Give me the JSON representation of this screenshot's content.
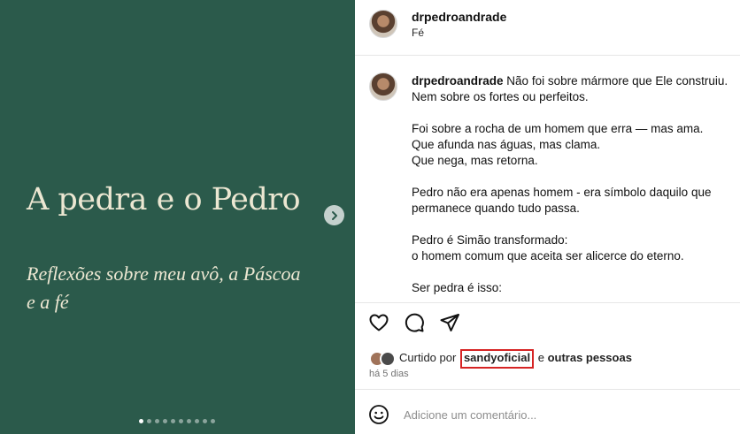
{
  "slide": {
    "title": "A pedra e o Pedro",
    "subtitle": "Reflexões sobre meu avô, a Páscoa e a fé",
    "background": "#2b5a4b",
    "text_color": "#ece7d2",
    "dots_total": 10,
    "active_dot": 1
  },
  "header": {
    "username": "drpedroandrade",
    "subtitle": "Fé"
  },
  "caption": {
    "username": "drpedroandrade",
    "first_line": "Não foi sobre mármore que Ele construiu.",
    "paragraphs": [
      "Nem sobre os fortes ou perfeitos.",
      "Foi sobre a rocha de um homem que erra — mas ama.\nQue afunda nas águas, mas clama.\nQue nega, mas retorna.",
      "Pedro não era apenas homem - era símbolo daquilo que permanece quando tudo passa.",
      "Pedro é Simão transformado:\no homem comum que aceita ser alicerce do eterno.",
      "Ser pedra é isso:"
    ]
  },
  "actions": {
    "icons": [
      "heart-icon",
      "comment-icon",
      "share-icon"
    ]
  },
  "likes": {
    "prefix": "Curtido por",
    "liker": "sandyoficial",
    "connector": "e",
    "suffix": "outras pessoas",
    "highlight_color": "#d62424"
  },
  "timestamp": "há 5 dias",
  "comment": {
    "placeholder": "Adicione um comentário..."
  }
}
